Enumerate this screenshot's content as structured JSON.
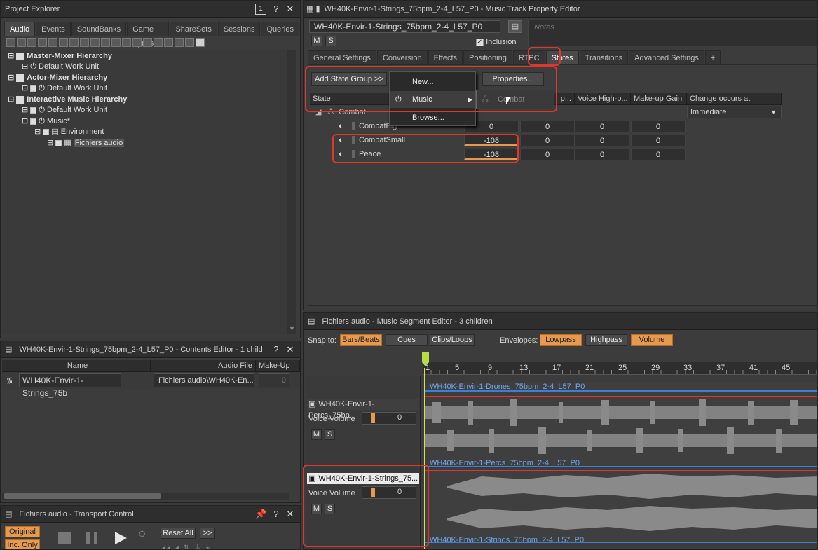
{
  "project_explorer": {
    "title": "Project Explorer",
    "tabs": [
      "Audio",
      "Events",
      "SoundBanks",
      "Game Syncs",
      "ShareSets",
      "Sessions",
      "Queries"
    ],
    "active_tab": "Audio",
    "tree": [
      {
        "label": "Master-Mixer Hierarchy",
        "bold": true
      },
      {
        "label": "Default Work Unit",
        "bold": false
      },
      {
        "label": "Actor-Mixer Hierarchy",
        "bold": true
      },
      {
        "label": "Default Work Unit",
        "bold": false
      },
      {
        "label": "Interactive Music Hierarchy",
        "bold": true
      },
      {
        "label": "Default Work Unit",
        "bold": false
      },
      {
        "label": "Music*",
        "bold": false
      },
      {
        "label": "Environment",
        "bold": false
      },
      {
        "label": "Fichiers audio",
        "bold": false
      }
    ]
  },
  "contents_editor": {
    "title": "WH40K-Envir-1-Strings_75bpm_2-4_L57_P0 - Contents Editor - 1 child",
    "columns": [
      "Name",
      "Audio File",
      "Make-Up Ga"
    ],
    "row": {
      "name": "WH40K-Envir-1-Strings_75b",
      "audio_file": "Fichiers audio\\WH40K-En...",
      "makeup": "0"
    }
  },
  "transport": {
    "title": "Fichiers audio - Transport Control",
    "original_label": "Original",
    "inc_only_label": "Inc. Only",
    "reset_all_label": "Reset All",
    "more_label": ">>"
  },
  "property_editor": {
    "title": "WH40K-Envir-1-Strings_75bpm_2-4_L57_P0 - Music Track Property Editor",
    "name_value": "WH40K-Envir-1-Strings_75bpm_2-4_L57_P0",
    "notes_placeholder": "Notes",
    "m_label": "M",
    "s_label": "S",
    "inclusion_label": "Inclusion",
    "tabs": [
      "General Settings",
      "Conversion",
      "Effects",
      "Positioning",
      "RTPC",
      "States",
      "Transitions",
      "Advanced Settings",
      "+"
    ],
    "active_tab": "States",
    "add_state_group_label": "Add State Group >>",
    "properties_label": "Properties...",
    "columns": [
      "State",
      "p...",
      "Voice High-p...",
      "Make-up Gain",
      "Change occurs at"
    ],
    "group_name": "Combat",
    "change_occurs_value": "Immediate",
    "states": [
      {
        "name": "CombatBig",
        "values": [
          "0",
          "0",
          "0",
          "0"
        ]
      },
      {
        "name": "CombatSmall",
        "values": [
          "-108",
          "0",
          "0",
          "0"
        ]
      },
      {
        "name": "Peace",
        "values": [
          "-108",
          "0",
          "0",
          "0"
        ]
      }
    ],
    "menu": {
      "new": "New...",
      "music": "Music",
      "browse": "Browse...",
      "submenu_item": "Combat"
    }
  },
  "segment_editor": {
    "title": "Fichiers audio - Music Segment Editor - 3 children",
    "snap_to_label": "Snap to:",
    "snap_options": [
      "Bars/Beats",
      "Cues",
      "Clips/Loops"
    ],
    "envelopes_label": "Envelopes:",
    "envelope_options": [
      "Lowpass",
      "Highpass",
      "Volume"
    ],
    "ruler": [
      "1",
      "5",
      "9",
      "13",
      "17",
      "21",
      "25",
      "29",
      "33",
      "37",
      "41",
      "45"
    ],
    "tracks": [
      {
        "name": "WH40K-Envir-1-Percs_75bp...",
        "voice_volume_label": "Voice Volume",
        "volume": "0"
      },
      {
        "name": "WH40K-Envir-1-Strings_75...",
        "voice_volume_label": "Voice Volume",
        "volume": "0"
      }
    ],
    "clip_labels": [
      "WH40K-Envir-1-Drones_75bpm_2-4_L57_P0",
      "WH40K-Envir-1-Percs_75bpm_2-4_L57_P0",
      "WH40K-Envir-1-Strings_75bpm_2-4_L57_P0"
    ]
  },
  "colors": {
    "accent_orange": "#e59a4f",
    "highlight_red": "#e0362c",
    "clip_blue": "#3d7ed6"
  }
}
